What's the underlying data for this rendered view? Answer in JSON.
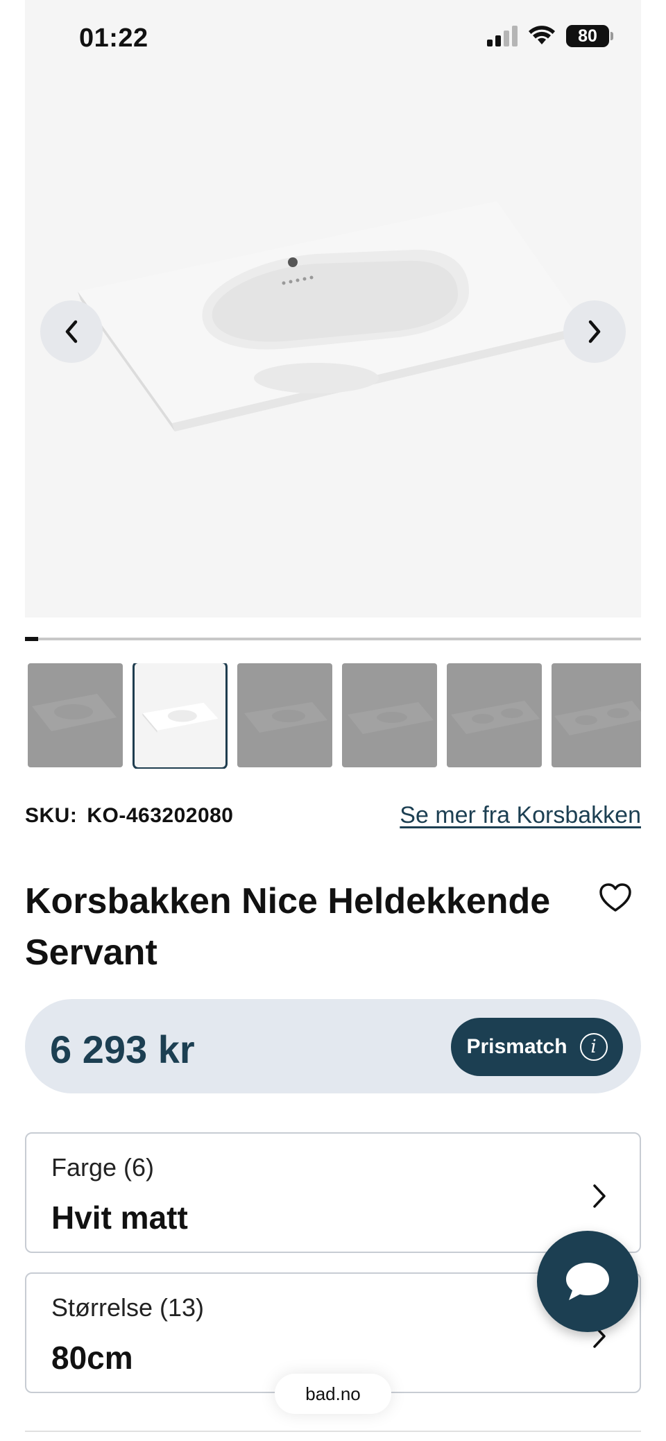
{
  "status_bar": {
    "time": "01:22",
    "battery": "80"
  },
  "gallery": {
    "image_count": 6,
    "active_index": 1,
    "progress_fraction": 0.03
  },
  "product": {
    "sku_label": "SKU:",
    "sku_value": "KO-463202080",
    "brand_link": "Se mer fra Korsbakken",
    "title": "Korsbakken Nice Heldekkende Servant",
    "price": "6 293 kr",
    "prismatch_label": "Prismatch"
  },
  "options": {
    "color": {
      "label": "Farge (6)",
      "value": "Hvit matt"
    },
    "size": {
      "label": "Størrelse (13)",
      "value": "80cm"
    }
  },
  "browser": {
    "url": "bad.no"
  },
  "colors": {
    "brand": "#1c3f52",
    "price_bg": "#e3e8ef"
  },
  "icons": [
    "chevron-left-icon",
    "chevron-right-icon",
    "heart-icon",
    "info-icon",
    "chat-icon",
    "wifi-icon",
    "signal-icon",
    "battery-icon"
  ]
}
